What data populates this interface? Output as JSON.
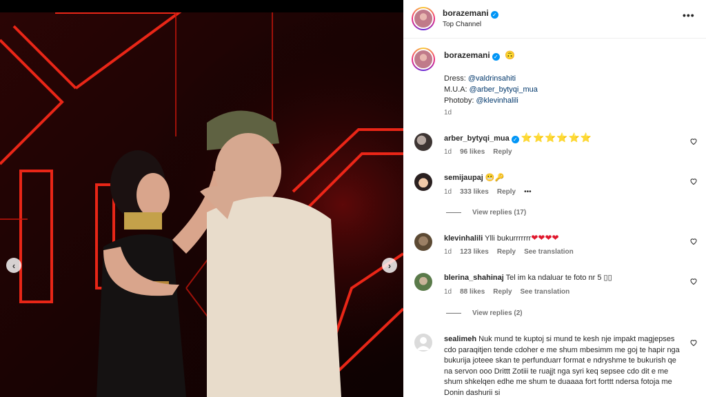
{
  "post": {
    "username": "borazemani",
    "subtitle": "Top Channel"
  },
  "caption": {
    "username": "borazemani",
    "emoji": "🙃",
    "line1_prefix": "Dress: ",
    "line1_link": "@valdrinsahiti",
    "line2_prefix": "M.U.A: ",
    "line2_link": "@arber_bytyqi_mua",
    "line3_prefix": "Photoby: ",
    "line3_link": "@klevinhalili",
    "time": "1d"
  },
  "comments": [
    {
      "username": "arber_bytyqi_mua",
      "verified": true,
      "text": "⭐⭐⭐⭐⭐⭐",
      "time": "1d",
      "likes": "96 likes",
      "reply": "Reply",
      "translation": ""
    },
    {
      "username": "semijaupaj",
      "verified": false,
      "text": "😬🔑",
      "time": "1d",
      "likes": "333 likes",
      "reply": "Reply",
      "more": "•••",
      "view_replies": "View replies (17)"
    },
    {
      "username": "klevinhalili",
      "verified": false,
      "text": "Ylli bukurrrrrrr",
      "text_suffix": "❤❤❤❤",
      "time": "1d",
      "likes": "123 likes",
      "reply": "Reply",
      "translation": "See translation"
    },
    {
      "username": "blerina_shahinaj",
      "verified": false,
      "text": "Tel im ka ndaluar te foto nr 5 ▯▯",
      "time": "1d",
      "likes": "88 likes",
      "reply": "Reply",
      "translation": "See translation",
      "view_replies": "View replies (2)"
    },
    {
      "username": "sealimeh",
      "verified": false,
      "text": "Nuk mund te kuptoj si mund te kesh nje impakt magjepses cdo paraqitjen tende cdoher e me shum mbesimm me goj te hapir nga bukurija joteee skan te perfunduarr format e ndryshme te bukurish qe na servon ooo Drittt Zotiii te ruajjt nga syri keq sepsee cdo dit e me shum shkelqen edhe me shum te duaaaa fort forttt ndersa fotoja me Donin dashurii si"
    }
  ],
  "icons": {
    "more": "more-horizontal-icon",
    "heart": "heart-outline-icon",
    "prev": "chevron-left-icon",
    "next": "chevron-right-icon"
  }
}
